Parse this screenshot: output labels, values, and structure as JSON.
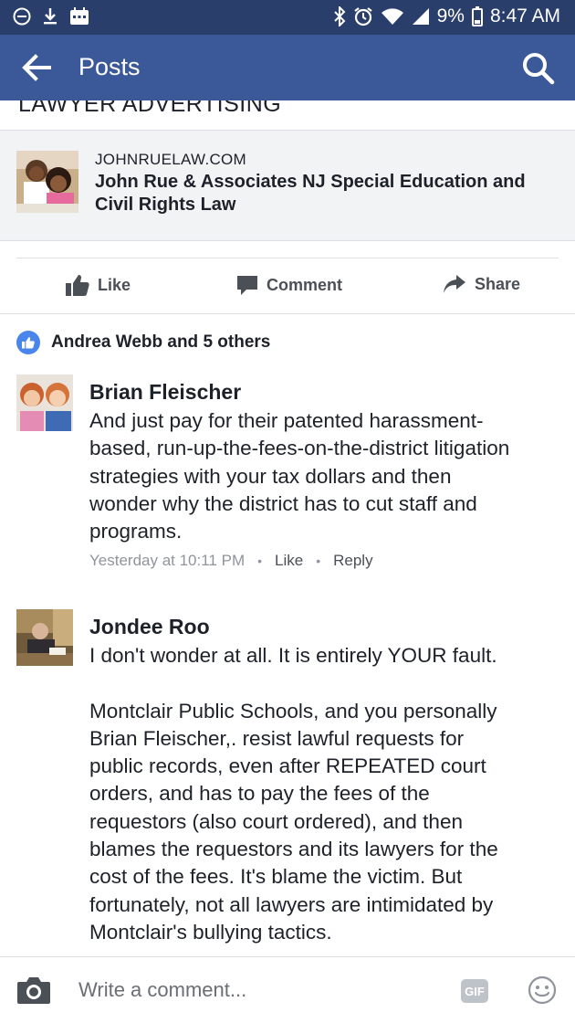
{
  "status_bar": {
    "battery": "9%",
    "time": "8:47 AM"
  },
  "app_bar": {
    "title": "Posts"
  },
  "post": {
    "lawyer_advertising": "LAWYER ADVERTISING",
    "link": {
      "domain": "JOHNRUELAW.COM",
      "title": "John Rue & Associates NJ Special Education and Civil Rights Law"
    },
    "actions": {
      "like": "Like",
      "comment": "Comment",
      "share": "Share"
    },
    "reactions": "Andrea Webb and 5 others"
  },
  "comments": [
    {
      "author": "Brian Fleischer",
      "lines": [
        "And just pay for their patented harassment-",
        "based, run-up-the-fees-on-the-district litigation",
        "strategies with your tax dollars and then",
        "wonder why the district has to cut staff and",
        "programs."
      ],
      "timestamp": "Yesterday at 10:11 PM",
      "like": "Like",
      "reply": "Reply"
    },
    {
      "author": "Jondee Roo",
      "lines": [
        "I don't wonder at all.  It is entirely YOUR fault.",
        "",
        "Montclair Public Schools, and you personally",
        "Brian Fleischer,. resist lawful requests for",
        "public records, even after REPEATED court",
        "orders, and has to pay the fees of the",
        "requestors (also court ordered), and then",
        "blames the requestors and its lawyers for the",
        "cost of the fees.  It's blame the victim.  But",
        "fortunately, not all lawyers are intimidated by",
        "Montclair's bullying tactics."
      ]
    }
  ],
  "composer": {
    "placeholder": "Write a comment...",
    "gif_label": "GIF"
  },
  "colors": {
    "status_bar": "#293e6a",
    "app_bar": "#3b5998",
    "like_badge": "#4a85ec",
    "meta_text": "#90949c"
  },
  "icons": [
    "dnd-icon",
    "download-icon",
    "calendar-icon",
    "bluetooth-icon",
    "alarm-icon",
    "wifi-icon",
    "signal-icon",
    "battery-icon",
    "back-arrow-icon",
    "search-icon",
    "thumbs-up-icon",
    "comment-bubble-icon",
    "share-arrow-icon",
    "camera-icon",
    "emoji-icon"
  ]
}
